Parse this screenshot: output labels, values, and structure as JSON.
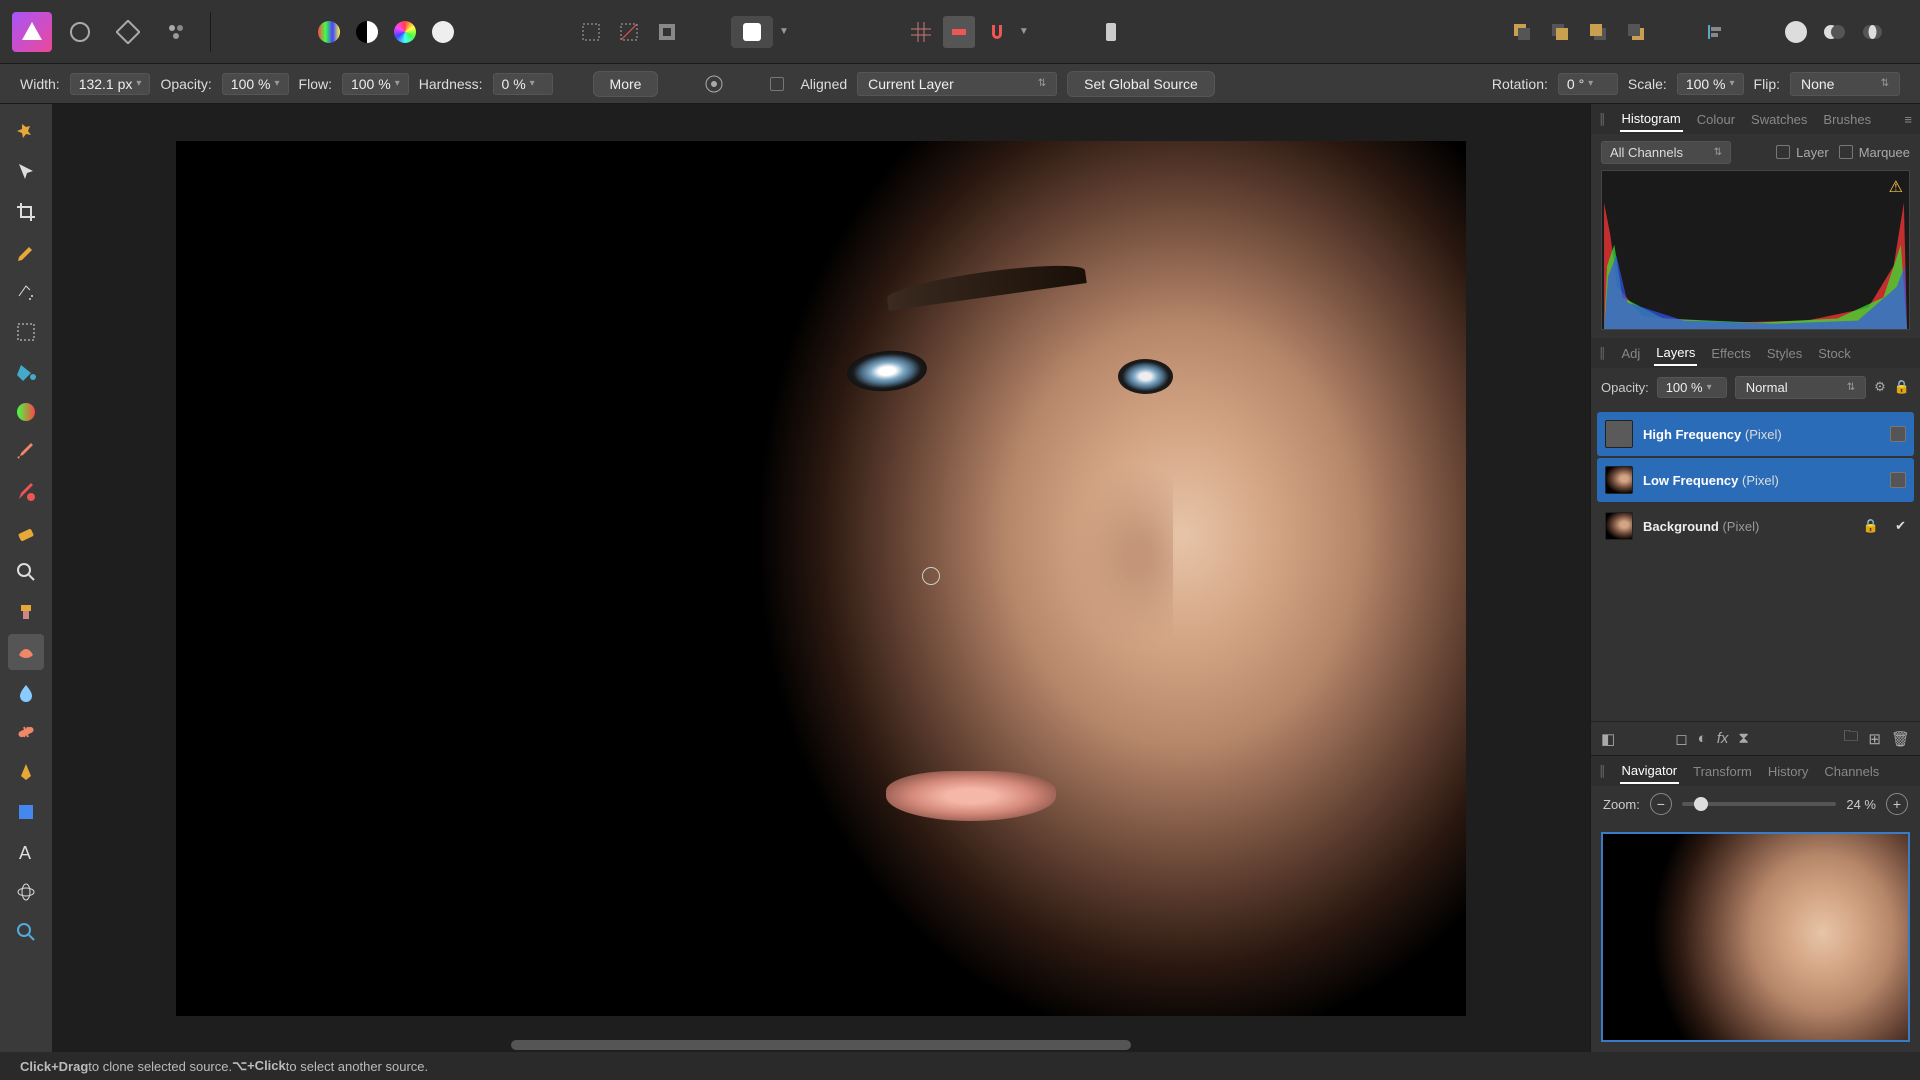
{
  "context_toolbar": {
    "width_label": "Width:",
    "width_value": "132.1 px",
    "opacity_label": "Opacity:",
    "opacity_value": "100 %",
    "flow_label": "Flow:",
    "flow_value": "100 %",
    "hardness_label": "Hardness:",
    "hardness_value": "0 %",
    "more_button": "More",
    "aligned_label": "Aligned",
    "source_layer": "Current Layer",
    "set_global_source": "Set Global Source",
    "rotation_label": "Rotation:",
    "rotation_value": "0 °",
    "scale_label": "Scale:",
    "scale_value": "100 %",
    "flip_label": "Flip:",
    "flip_value": "None"
  },
  "histogram_panel": {
    "tabs": [
      "Histogram",
      "Colour",
      "Swatches",
      "Brushes"
    ],
    "channel_select": "All Channels",
    "layer_checkbox": "Layer",
    "marquee_checkbox": "Marquee"
  },
  "layers_panel": {
    "tabs": [
      "Adj",
      "Layers",
      "Effects",
      "Styles",
      "Stock"
    ],
    "opacity_label": "Opacity:",
    "opacity_value": "100 %",
    "blend_mode": "Normal",
    "layers": [
      {
        "name": "High Frequency",
        "type": "(Pixel)",
        "selected": true,
        "thumb": "grey"
      },
      {
        "name": "Low Frequency",
        "type": "(Pixel)",
        "selected": true,
        "thumb": "img"
      },
      {
        "name": "Background",
        "type": "(Pixel)",
        "selected": false,
        "thumb": "img",
        "locked": true
      }
    ]
  },
  "navigator_panel": {
    "tabs": [
      "Navigator",
      "Transform",
      "History",
      "Channels"
    ],
    "zoom_label": "Zoom:",
    "zoom_value": "24 %"
  },
  "status": {
    "hint_bold1": "Click+Drag",
    "hint_text1": " to clone selected source. ",
    "hint_bold2": "⌥+Click",
    "hint_text2": " to select another source."
  }
}
